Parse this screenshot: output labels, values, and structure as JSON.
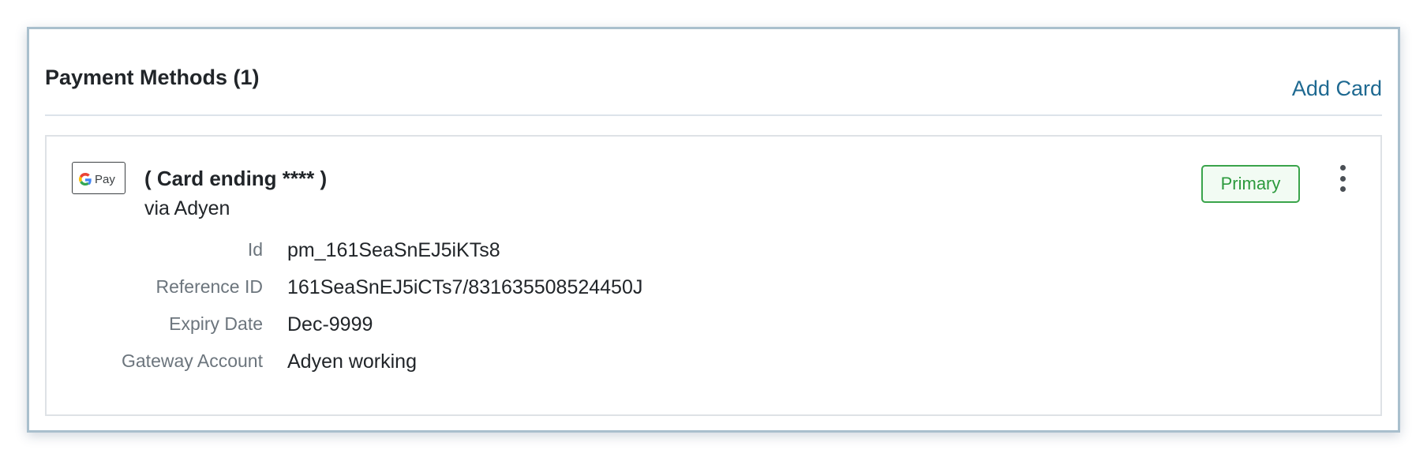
{
  "section": {
    "title": "Payment Methods (1)",
    "add_card_label": "Add Card"
  },
  "card": {
    "brand_icon": "google-pay-icon",
    "brand_icon_text": "Pay",
    "title": "( Card ending **** )",
    "subtitle": "via Adyen",
    "badge": "Primary",
    "menu_icon": "more-vertical-icon",
    "details": [
      {
        "label": "Id",
        "value": "pm_161SeaSnEJ5iKTs8"
      },
      {
        "label": "Reference ID",
        "value": "161SeaSnEJ5iCTs7/831635508524450J"
      },
      {
        "label": "Expiry Date",
        "value": "Dec-9999"
      },
      {
        "label": "Gateway Account",
        "value": "Adyen working"
      }
    ]
  },
  "colors": {
    "link": "#1e6991",
    "badge_green": "#2c9a3d",
    "frame_border": "#a9bfcd",
    "label_gray": "#6c757d"
  }
}
